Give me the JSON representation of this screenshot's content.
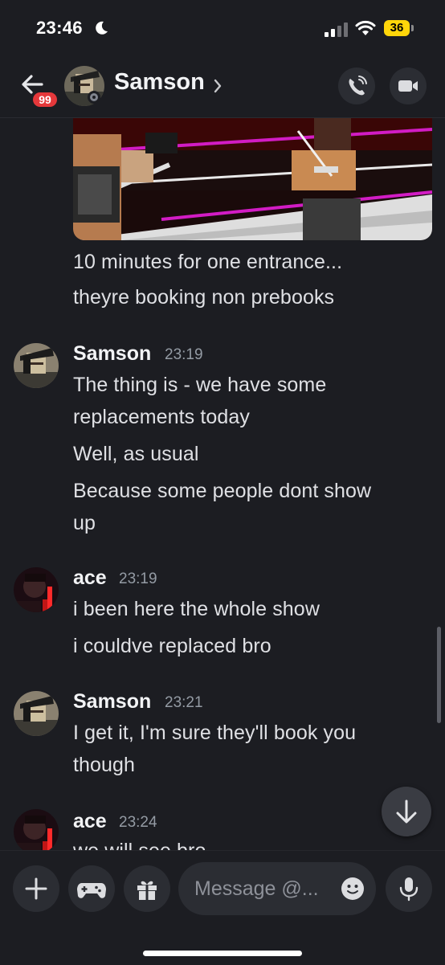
{
  "status_bar": {
    "time": "23:46",
    "battery": "36"
  },
  "header": {
    "badge": "99",
    "name": "Samson"
  },
  "messages": {
    "group0": {
      "lines": [
        "10 minutes for one entrance...",
        "theyre booking non prebooks"
      ]
    },
    "group1": {
      "author": "Samson",
      "time": "23:19",
      "lines": [
        "The thing is - we have some",
        "replacements today",
        "Well, as usual",
        "Because some people dont show",
        "up"
      ]
    },
    "group2": {
      "author": "ace",
      "time": "23:19",
      "lines": [
        "i been here the whole show",
        "i couldve replaced bro"
      ]
    },
    "group3": {
      "author": "Samson",
      "time": "23:21",
      "lines": [
        "I get it, I'm sure they'll book you",
        "though"
      ]
    },
    "group4": {
      "author": "ace",
      "time": "23:24",
      "lines": [
        "we will see bro"
      ]
    }
  },
  "composer": {
    "placeholder": "Message @..."
  },
  "colors": {
    "background": "#1c1d22",
    "surface": "#2b2d33",
    "badge": "#e5383b",
    "battery": "#ffd60a",
    "timestamp": "#949ba4"
  },
  "icons": [
    "moon-icon",
    "signal-icon",
    "wifi-icon",
    "battery-icon",
    "back-arrow-icon",
    "chevron-right-icon",
    "phone-call-icon",
    "video-camera-icon",
    "arrow-down-icon",
    "plus-icon",
    "gamepad-icon",
    "gift-icon",
    "emoji-icon",
    "microphone-icon"
  ]
}
